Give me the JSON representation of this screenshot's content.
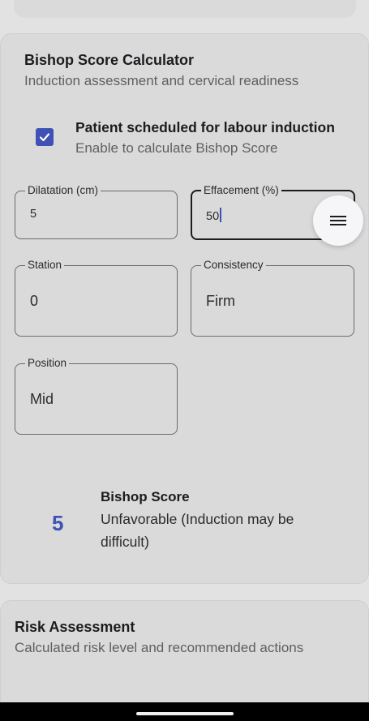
{
  "bishop_card": {
    "title": "Bishop Score Calculator",
    "subtitle": "Induction assessment and cervical readiness",
    "checkbox": {
      "checked": true,
      "title": "Patient scheduled for labour induction",
      "subtitle": "Enable to calculate Bishop Score"
    },
    "fields": {
      "dilatation": {
        "label": "Dilatation (cm)",
        "value": "5"
      },
      "effacement": {
        "label": "Effacement (%)",
        "value": "50"
      },
      "station": {
        "label": "Station",
        "value": "0"
      },
      "consistency": {
        "label": "Consistency",
        "value": "Firm"
      },
      "position": {
        "label": "Position",
        "value": "Mid"
      }
    },
    "result": {
      "score": "5",
      "title": "Bishop Score",
      "description": "Unfavorable (Induction may be difficult)"
    }
  },
  "risk_card": {
    "title": "Risk Assessment",
    "subtitle": "Calculated risk level and recommended actions"
  },
  "fab": {
    "icon": "menu-icon"
  },
  "colors": {
    "accent": "#3f51b5",
    "card_background": "#dadada",
    "page_background": "#e2e2e2"
  }
}
